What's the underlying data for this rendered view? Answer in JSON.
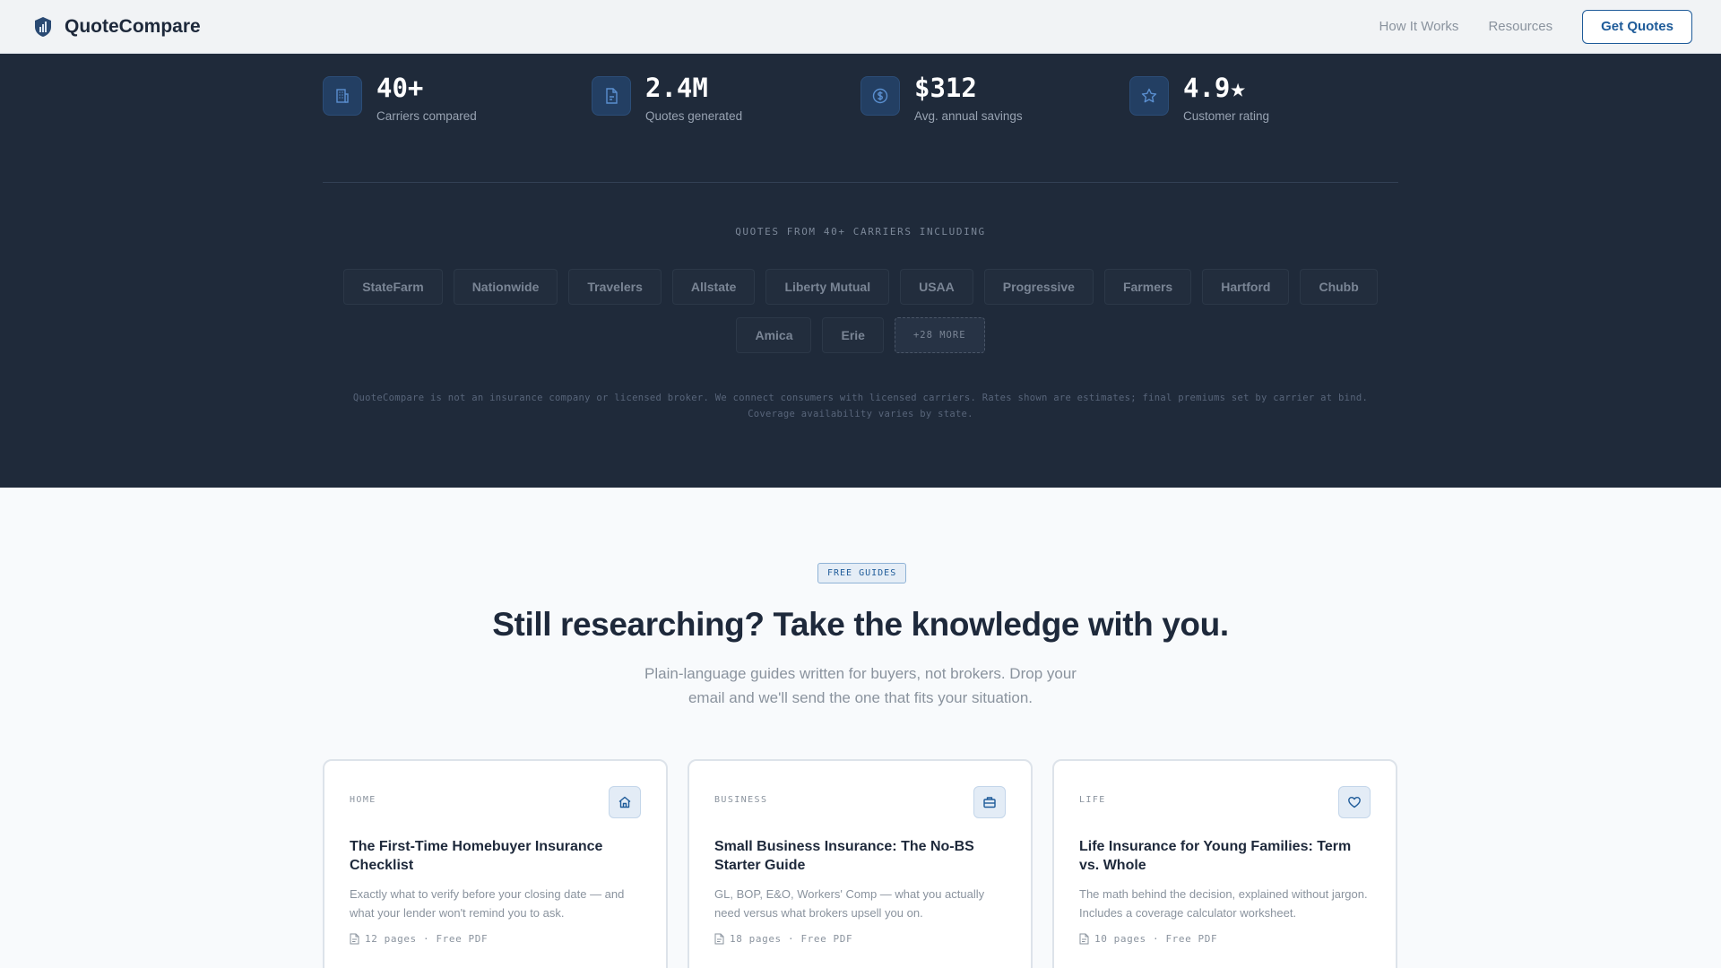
{
  "nav": {
    "brand": "QuoteCompare",
    "links": [
      "How It Works",
      "Resources"
    ],
    "cta": "Get Quotes"
  },
  "stats": [
    {
      "icon": "building-icon",
      "value": "40+",
      "label": "Carriers compared"
    },
    {
      "icon": "document-icon",
      "value": "2.4M",
      "label": "Quotes generated"
    },
    {
      "icon": "dollar-icon",
      "value": "$312",
      "label": "Avg. annual savings"
    },
    {
      "icon": "star-icon",
      "value": "4.9★",
      "label": "Customer rating"
    }
  ],
  "carriers": {
    "heading": "QUOTES FROM 40+ CARRIERS INCLUDING",
    "row1": [
      "StateFarm",
      "Nationwide",
      "Travelers",
      "Allstate",
      "Liberty Mutual",
      "USAA",
      "Progressive",
      "Farmers",
      "Hartford",
      "Chubb"
    ],
    "row2": [
      "Amica",
      "Erie"
    ],
    "more": "+28 MORE"
  },
  "disclaimer": "QuoteCompare is not an insurance company or licensed broker. We connect consumers with licensed carriers. Rates shown are estimates; final premiums set by carrier at bind. Coverage availability varies by state.",
  "guides": {
    "badge": "FREE GUIDES",
    "headline": "Still researching? Take the knowledge with you.",
    "subhead": "Plain-language guides written for buyers, not brokers. Drop your email and we'll send the one that fits your situation.",
    "cards": [
      {
        "category": "HOME",
        "icon": "home-icon",
        "title": "The First-Time Homebuyer Insurance Checklist",
        "desc": "Exactly what to verify before your closing date — and what your lender won't remind you to ask.",
        "meta": "12 pages · Free PDF"
      },
      {
        "category": "BUSINESS",
        "icon": "briefcase-icon",
        "title": "Small Business Insurance: The No-BS Starter Guide",
        "desc": "GL, BOP, E&O, Workers' Comp — what you actually need versus what brokers upsell you on.",
        "meta": "18 pages · Free PDF"
      },
      {
        "category": "LIFE",
        "icon": "heart-icon",
        "title": "Life Insurance for Young Families: Term vs. Whole",
        "desc": "The math behind the decision, explained without jargon. Includes a coverage calculator worksheet.",
        "meta": "10 pages · Free PDF"
      }
    ]
  },
  "colors": {
    "accent": "#1e5b99",
    "dark_band": "#1f2a3a",
    "page_bg": "#f8fafc"
  }
}
